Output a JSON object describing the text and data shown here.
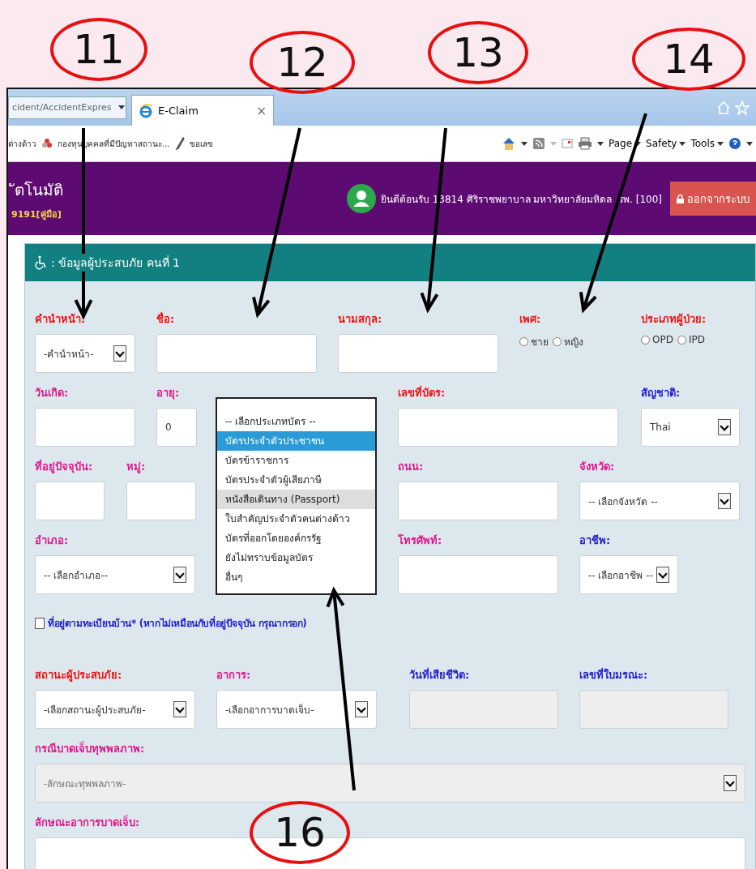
{
  "annotations": [
    {
      "label": "11"
    },
    {
      "label": "12"
    },
    {
      "label": "13"
    },
    {
      "label": "14"
    },
    {
      "label": "16"
    }
  ],
  "browser": {
    "address": "cident/AccidentExpres",
    "tab_title": "E-Claim",
    "tab_close": "×",
    "favorites": [
      {
        "label": "ต่างด้าว",
        "kind": "plain"
      },
      {
        "label": "กองทุนบุคคลที่มีปัญหาสถานะ...",
        "kind": "flower"
      },
      {
        "label": "ขอเลข",
        "kind": "pen"
      }
    ],
    "commands": [
      "Page",
      "Safety",
      "Tools"
    ]
  },
  "header": {
    "title": "ัตโนมัติ",
    "subtitle": "9191[คู่มือ]",
    "welcome": "ยินดีต้อนรับ 13814 ศิริราชพยาบาล มหาวิทยาลัยมหิดล ,รพ. [100]",
    "logout": "ออกจากระบบ"
  },
  "panel": {
    "title": ": ข้อมูลผู้ประสบภัย คนที่ 1",
    "rows": [
      [
        {
          "label": "คำนำหน้า:",
          "color": "#ee1111",
          "kind": "select",
          "value": "-คำนำหน้า-"
        },
        {
          "label": "ชื่อ:",
          "color": "#ee1111",
          "kind": "text"
        },
        {
          "label": "นามสกุล:",
          "color": "#ee1111",
          "kind": "text"
        },
        {
          "label": "เพศ:",
          "color": "#ee1111",
          "kind": "radio",
          "options": [
            {
              "label": "ชาย",
              "selected": false
            },
            {
              "label": "หญิง",
              "selected": false
            }
          ]
        },
        {
          "label": "ประเภทผู้ป่วย:",
          "color": "#ee1111",
          "kind": "radio",
          "options": [
            {
              "label": "OPD",
              "selected": false
            },
            {
              "label": "IPD",
              "selected": false
            }
          ]
        }
      ],
      [
        {
          "label": "วันเกิด:",
          "color": "#e0168a",
          "kind": "text"
        },
        {
          "label": "อายุ:",
          "color": "#e0168a",
          "kind": "text",
          "value": "0"
        },
        "",
        {
          "label": "เลขที่บัตร:",
          "color": "#ee1111",
          "kind": "text"
        },
        {
          "label": "สัญชาติ:",
          "color": "#2020cc",
          "kind": "select",
          "value": "Thai"
        }
      ],
      [
        {
          "label": "ที่อยู่ปัจจุบัน:",
          "color": "#e0168a",
          "kind": "text"
        },
        {
          "label": "หมู่:",
          "color": "#e0168a",
          "kind": "text"
        },
        "",
        {
          "label": "ถนน:",
          "color": "#e0168a",
          "kind": "text"
        },
        {
          "label": "จังหวัด:",
          "color": "#e0168a",
          "kind": "select",
          "value": "-- เลือกจังหวัด --"
        }
      ],
      [
        {
          "label": "อำเภอ:",
          "color": "#e0168a",
          "kind": "select",
          "value": "-- เลือกอำเภอ--"
        },
        "",
        "",
        {
          "label": "โทรศัพท์:",
          "color": "#e0168a",
          "kind": "text"
        },
        {
          "label": "อาชีพ:",
          "color": "#2020cc",
          "kind": "select",
          "value": "-- เลือกอาชีพ --"
        }
      ]
    ],
    "checkbox": {
      "label": "ที่อยู่ตามทะเบียนบ้าน* (หากไม่เหมือนกับที่อยู่ปัจจุบัน กรุณากรอก)",
      "checked": false
    },
    "rows2": [
      [
        {
          "label": "สถานะผู้ประสบภัย:",
          "color": "#ee1111",
          "kind": "select",
          "value": "-เลือกสถานะผู้ประสบภัย-"
        },
        {
          "label": "อาการ:",
          "color": "#e0168a",
          "kind": "select",
          "value": "-เลือกอาการบาดเจ็บ-"
        },
        {
          "label": "วันที่เสียชีวิต:",
          "color": "#2020cc",
          "kind": "disabled"
        },
        {
          "label": "เลขที่ใบมรณะ:",
          "color": "#2020cc",
          "kind": "disabled"
        }
      ],
      [
        {
          "label": "กรณีบาดเจ็บทุพพลภาพ:",
          "color": "#e0168a",
          "kind": "disabledselect",
          "value": "-ลักษณะทุพพลภาพ-"
        }
      ],
      [
        {
          "label": "ลักษณะอาการบาดเจ็บ:",
          "color": "#e0168a",
          "kind": "text"
        }
      ]
    ]
  },
  "card_type_list": [
    {
      "label": "-- เลือกประเภทบัตร --",
      "selected": false,
      "hovered": false
    },
    {
      "label": "บัตรประจำตัวประชาชน",
      "selected": true,
      "hovered": false
    },
    {
      "label": "บัตรข้าราชการ",
      "selected": false,
      "hovered": false
    },
    {
      "label": "บัตรประจำตัวผู้เสียภาษี",
      "selected": false,
      "hovered": false
    },
    {
      "label": "หนังสือเดินทาง (Passport)",
      "selected": false,
      "hovered": true
    },
    {
      "label": "ใบสำคัญประจำตัวคนต่างด้าว",
      "selected": false,
      "hovered": false
    },
    {
      "label": "บัตรที่ออกโดยองค์กรรัฐ",
      "selected": false,
      "hovered": false
    },
    {
      "label": "ยังไม่ทราบข้อมูลบัตร",
      "selected": false,
      "hovered": false
    },
    {
      "label": "อื่นๆ",
      "selected": false,
      "hovered": false
    }
  ]
}
